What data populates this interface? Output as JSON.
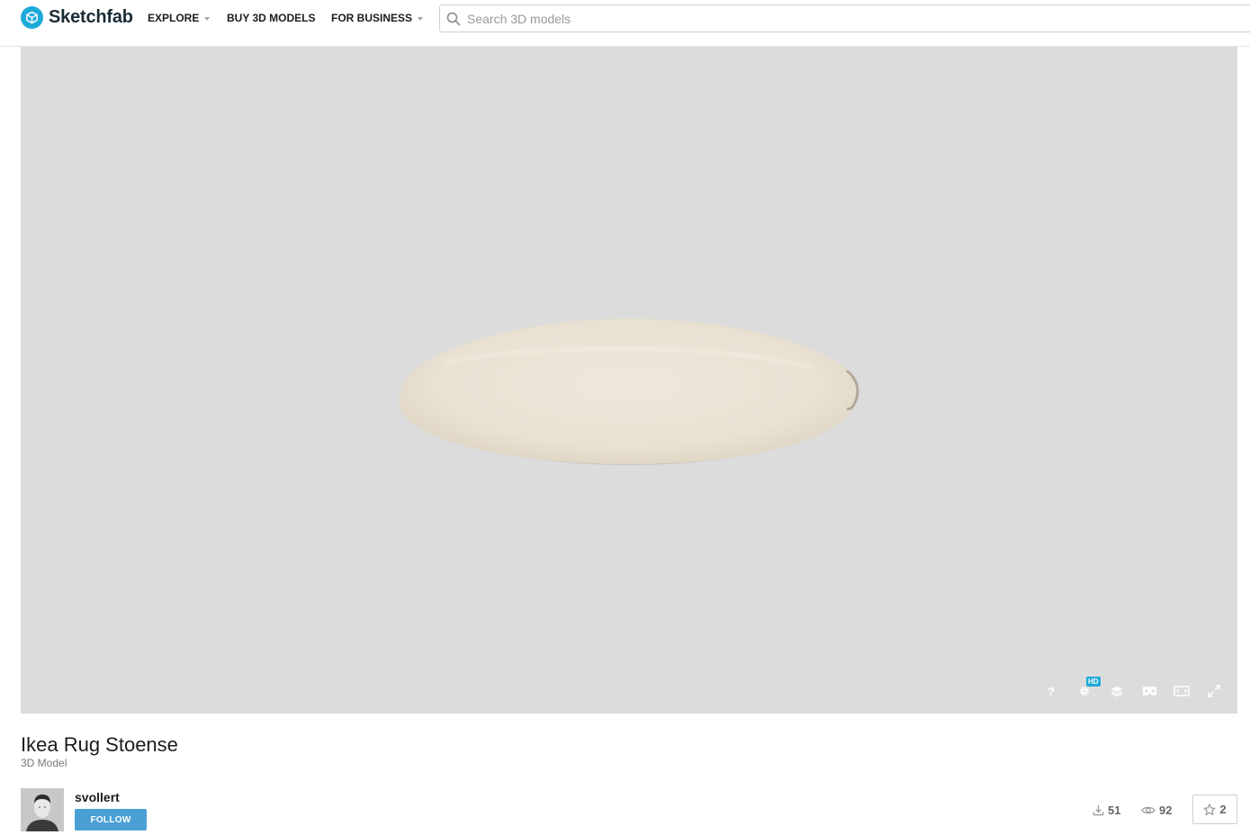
{
  "header": {
    "brand": "Sketchfab",
    "nav": [
      {
        "label": "EXPLORE",
        "has_caret": true
      },
      {
        "label": "BUY 3D MODELS",
        "has_caret": false
      },
      {
        "label": "FOR BUSINESS",
        "has_caret": true
      }
    ],
    "search": {
      "placeholder": "Search 3D models",
      "value": "",
      "icon": "search-icon"
    }
  },
  "viewer": {
    "background": "#dcdcdc",
    "model_color": "#ece4d6",
    "controls": [
      {
        "name": "help",
        "icon": "question-icon"
      },
      {
        "name": "settings",
        "icon": "gear-icon",
        "badge": "HD"
      },
      {
        "name": "layers",
        "icon": "layers-icon"
      },
      {
        "name": "vr",
        "icon": "vr-headset-icon"
      },
      {
        "name": "embed",
        "icon": "embed-icon"
      },
      {
        "name": "fullscreen",
        "icon": "fullscreen-icon"
      }
    ]
  },
  "model": {
    "title": "Ikea Rug Stoense",
    "subtitle": "3D Model",
    "author": {
      "username": "svollert",
      "follow_label": "FOLLOW"
    },
    "stats": {
      "downloads": "51",
      "views": "92",
      "likes": "2"
    }
  },
  "colors": {
    "accent": "#1caad9",
    "follow_button": "#4a9fd5",
    "text": "#1c1c1c",
    "muted": "#777777"
  }
}
